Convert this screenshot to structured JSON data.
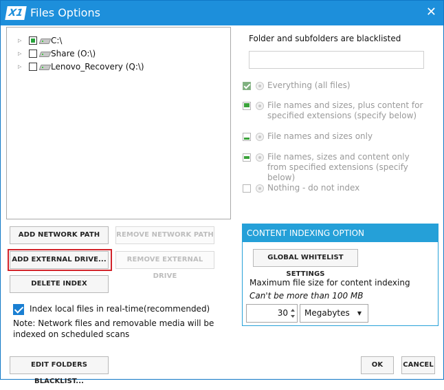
{
  "window": {
    "logo": "X1",
    "title": "Files Options",
    "close_glyph": "✕"
  },
  "tree": {
    "items": [
      {
        "label": "C:\\",
        "check_state": "partial"
      },
      {
        "label": "Share (O:\\)",
        "check_state": "unchecked"
      },
      {
        "label": "Lenovo_Recovery (Q:\\)",
        "check_state": "unchecked"
      }
    ]
  },
  "buttons": {
    "add_network_path": "ADD NETWORK PATH",
    "remove_network_path": "REMOVE NETWORK PATH",
    "add_external_drive": "ADD EXTERNAL DRIVE...",
    "remove_external_drive": "REMOVE EXTERNAL DRIVE",
    "delete_index": "DELETE INDEX",
    "edit_folders_blacklist": "EDIT FOLDERS BLACKLIST...",
    "ok": "OK",
    "cancel": "CANCEL"
  },
  "realtime": {
    "label": "Index local files in real-time(recommended)",
    "checked": true,
    "note": "Note: Network files and removable media will be indexed on scheduled scans"
  },
  "blacklist": {
    "label": "Folder and subfolders are blacklisted",
    "value": ""
  },
  "index_options": [
    {
      "label": "Everything (all files)",
      "icon": "full"
    },
    {
      "label": "File names and sizes, plus content for specified extensions (specify below)",
      "icon": "top"
    },
    {
      "label": "File names and sizes only",
      "icon": "bottom"
    },
    {
      "label": "File names, sizes and content only from specified extensions (specify below)",
      "icon": "middle"
    },
    {
      "label": "Nothing - do not index",
      "icon": "empty"
    }
  ],
  "content_panel": {
    "heading": "CONTENT INDEXING OPTION",
    "global_whitelist_button": "GLOBAL WHITELIST SETTINGS",
    "max_size_label": "Maximum file size for content indexing",
    "max_size_hint": "Can't be more than 100 MB",
    "max_size_value": "30",
    "unit_selected": "Megabytes"
  },
  "colors": {
    "titlebar": "#1d8fdb",
    "panel_header": "#25a0d8",
    "highlight_border": "#d2232a",
    "check_green": "#27a23b"
  }
}
